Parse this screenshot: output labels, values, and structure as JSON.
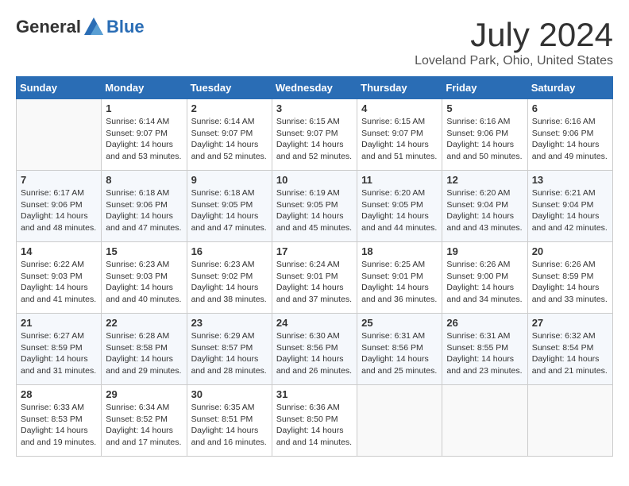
{
  "header": {
    "logo_general": "General",
    "logo_blue": "Blue",
    "title": "July 2024",
    "location": "Loveland Park, Ohio, United States"
  },
  "days_of_week": [
    "Sunday",
    "Monday",
    "Tuesday",
    "Wednesday",
    "Thursday",
    "Friday",
    "Saturday"
  ],
  "weeks": [
    [
      {
        "day": "",
        "empty": true
      },
      {
        "day": "1",
        "sunrise": "Sunrise: 6:14 AM",
        "sunset": "Sunset: 9:07 PM",
        "daylight": "Daylight: 14 hours and 53 minutes."
      },
      {
        "day": "2",
        "sunrise": "Sunrise: 6:14 AM",
        "sunset": "Sunset: 9:07 PM",
        "daylight": "Daylight: 14 hours and 52 minutes."
      },
      {
        "day": "3",
        "sunrise": "Sunrise: 6:15 AM",
        "sunset": "Sunset: 9:07 PM",
        "daylight": "Daylight: 14 hours and 52 minutes."
      },
      {
        "day": "4",
        "sunrise": "Sunrise: 6:15 AM",
        "sunset": "Sunset: 9:07 PM",
        "daylight": "Daylight: 14 hours and 51 minutes."
      },
      {
        "day": "5",
        "sunrise": "Sunrise: 6:16 AM",
        "sunset": "Sunset: 9:06 PM",
        "daylight": "Daylight: 14 hours and 50 minutes."
      },
      {
        "day": "6",
        "sunrise": "Sunrise: 6:16 AM",
        "sunset": "Sunset: 9:06 PM",
        "daylight": "Daylight: 14 hours and 49 minutes."
      }
    ],
    [
      {
        "day": "7",
        "sunrise": "Sunrise: 6:17 AM",
        "sunset": "Sunset: 9:06 PM",
        "daylight": "Daylight: 14 hours and 48 minutes."
      },
      {
        "day": "8",
        "sunrise": "Sunrise: 6:18 AM",
        "sunset": "Sunset: 9:06 PM",
        "daylight": "Daylight: 14 hours and 47 minutes."
      },
      {
        "day": "9",
        "sunrise": "Sunrise: 6:18 AM",
        "sunset": "Sunset: 9:05 PM",
        "daylight": "Daylight: 14 hours and 47 minutes."
      },
      {
        "day": "10",
        "sunrise": "Sunrise: 6:19 AM",
        "sunset": "Sunset: 9:05 PM",
        "daylight": "Daylight: 14 hours and 45 minutes."
      },
      {
        "day": "11",
        "sunrise": "Sunrise: 6:20 AM",
        "sunset": "Sunset: 9:05 PM",
        "daylight": "Daylight: 14 hours and 44 minutes."
      },
      {
        "day": "12",
        "sunrise": "Sunrise: 6:20 AM",
        "sunset": "Sunset: 9:04 PM",
        "daylight": "Daylight: 14 hours and 43 minutes."
      },
      {
        "day": "13",
        "sunrise": "Sunrise: 6:21 AM",
        "sunset": "Sunset: 9:04 PM",
        "daylight": "Daylight: 14 hours and 42 minutes."
      }
    ],
    [
      {
        "day": "14",
        "sunrise": "Sunrise: 6:22 AM",
        "sunset": "Sunset: 9:03 PM",
        "daylight": "Daylight: 14 hours and 41 minutes."
      },
      {
        "day": "15",
        "sunrise": "Sunrise: 6:23 AM",
        "sunset": "Sunset: 9:03 PM",
        "daylight": "Daylight: 14 hours and 40 minutes."
      },
      {
        "day": "16",
        "sunrise": "Sunrise: 6:23 AM",
        "sunset": "Sunset: 9:02 PM",
        "daylight": "Daylight: 14 hours and 38 minutes."
      },
      {
        "day": "17",
        "sunrise": "Sunrise: 6:24 AM",
        "sunset": "Sunset: 9:01 PM",
        "daylight": "Daylight: 14 hours and 37 minutes."
      },
      {
        "day": "18",
        "sunrise": "Sunrise: 6:25 AM",
        "sunset": "Sunset: 9:01 PM",
        "daylight": "Daylight: 14 hours and 36 minutes."
      },
      {
        "day": "19",
        "sunrise": "Sunrise: 6:26 AM",
        "sunset": "Sunset: 9:00 PM",
        "daylight": "Daylight: 14 hours and 34 minutes."
      },
      {
        "day": "20",
        "sunrise": "Sunrise: 6:26 AM",
        "sunset": "Sunset: 8:59 PM",
        "daylight": "Daylight: 14 hours and 33 minutes."
      }
    ],
    [
      {
        "day": "21",
        "sunrise": "Sunrise: 6:27 AM",
        "sunset": "Sunset: 8:59 PM",
        "daylight": "Daylight: 14 hours and 31 minutes."
      },
      {
        "day": "22",
        "sunrise": "Sunrise: 6:28 AM",
        "sunset": "Sunset: 8:58 PM",
        "daylight": "Daylight: 14 hours and 29 minutes."
      },
      {
        "day": "23",
        "sunrise": "Sunrise: 6:29 AM",
        "sunset": "Sunset: 8:57 PM",
        "daylight": "Daylight: 14 hours and 28 minutes."
      },
      {
        "day": "24",
        "sunrise": "Sunrise: 6:30 AM",
        "sunset": "Sunset: 8:56 PM",
        "daylight": "Daylight: 14 hours and 26 minutes."
      },
      {
        "day": "25",
        "sunrise": "Sunrise: 6:31 AM",
        "sunset": "Sunset: 8:56 PM",
        "daylight": "Daylight: 14 hours and 25 minutes."
      },
      {
        "day": "26",
        "sunrise": "Sunrise: 6:31 AM",
        "sunset": "Sunset: 8:55 PM",
        "daylight": "Daylight: 14 hours and 23 minutes."
      },
      {
        "day": "27",
        "sunrise": "Sunrise: 6:32 AM",
        "sunset": "Sunset: 8:54 PM",
        "daylight": "Daylight: 14 hours and 21 minutes."
      }
    ],
    [
      {
        "day": "28",
        "sunrise": "Sunrise: 6:33 AM",
        "sunset": "Sunset: 8:53 PM",
        "daylight": "Daylight: 14 hours and 19 minutes."
      },
      {
        "day": "29",
        "sunrise": "Sunrise: 6:34 AM",
        "sunset": "Sunset: 8:52 PM",
        "daylight": "Daylight: 14 hours and 17 minutes."
      },
      {
        "day": "30",
        "sunrise": "Sunrise: 6:35 AM",
        "sunset": "Sunset: 8:51 PM",
        "daylight": "Daylight: 14 hours and 16 minutes."
      },
      {
        "day": "31",
        "sunrise": "Sunrise: 6:36 AM",
        "sunset": "Sunset: 8:50 PM",
        "daylight": "Daylight: 14 hours and 14 minutes."
      },
      {
        "day": "",
        "empty": true
      },
      {
        "day": "",
        "empty": true
      },
      {
        "day": "",
        "empty": true
      }
    ]
  ]
}
